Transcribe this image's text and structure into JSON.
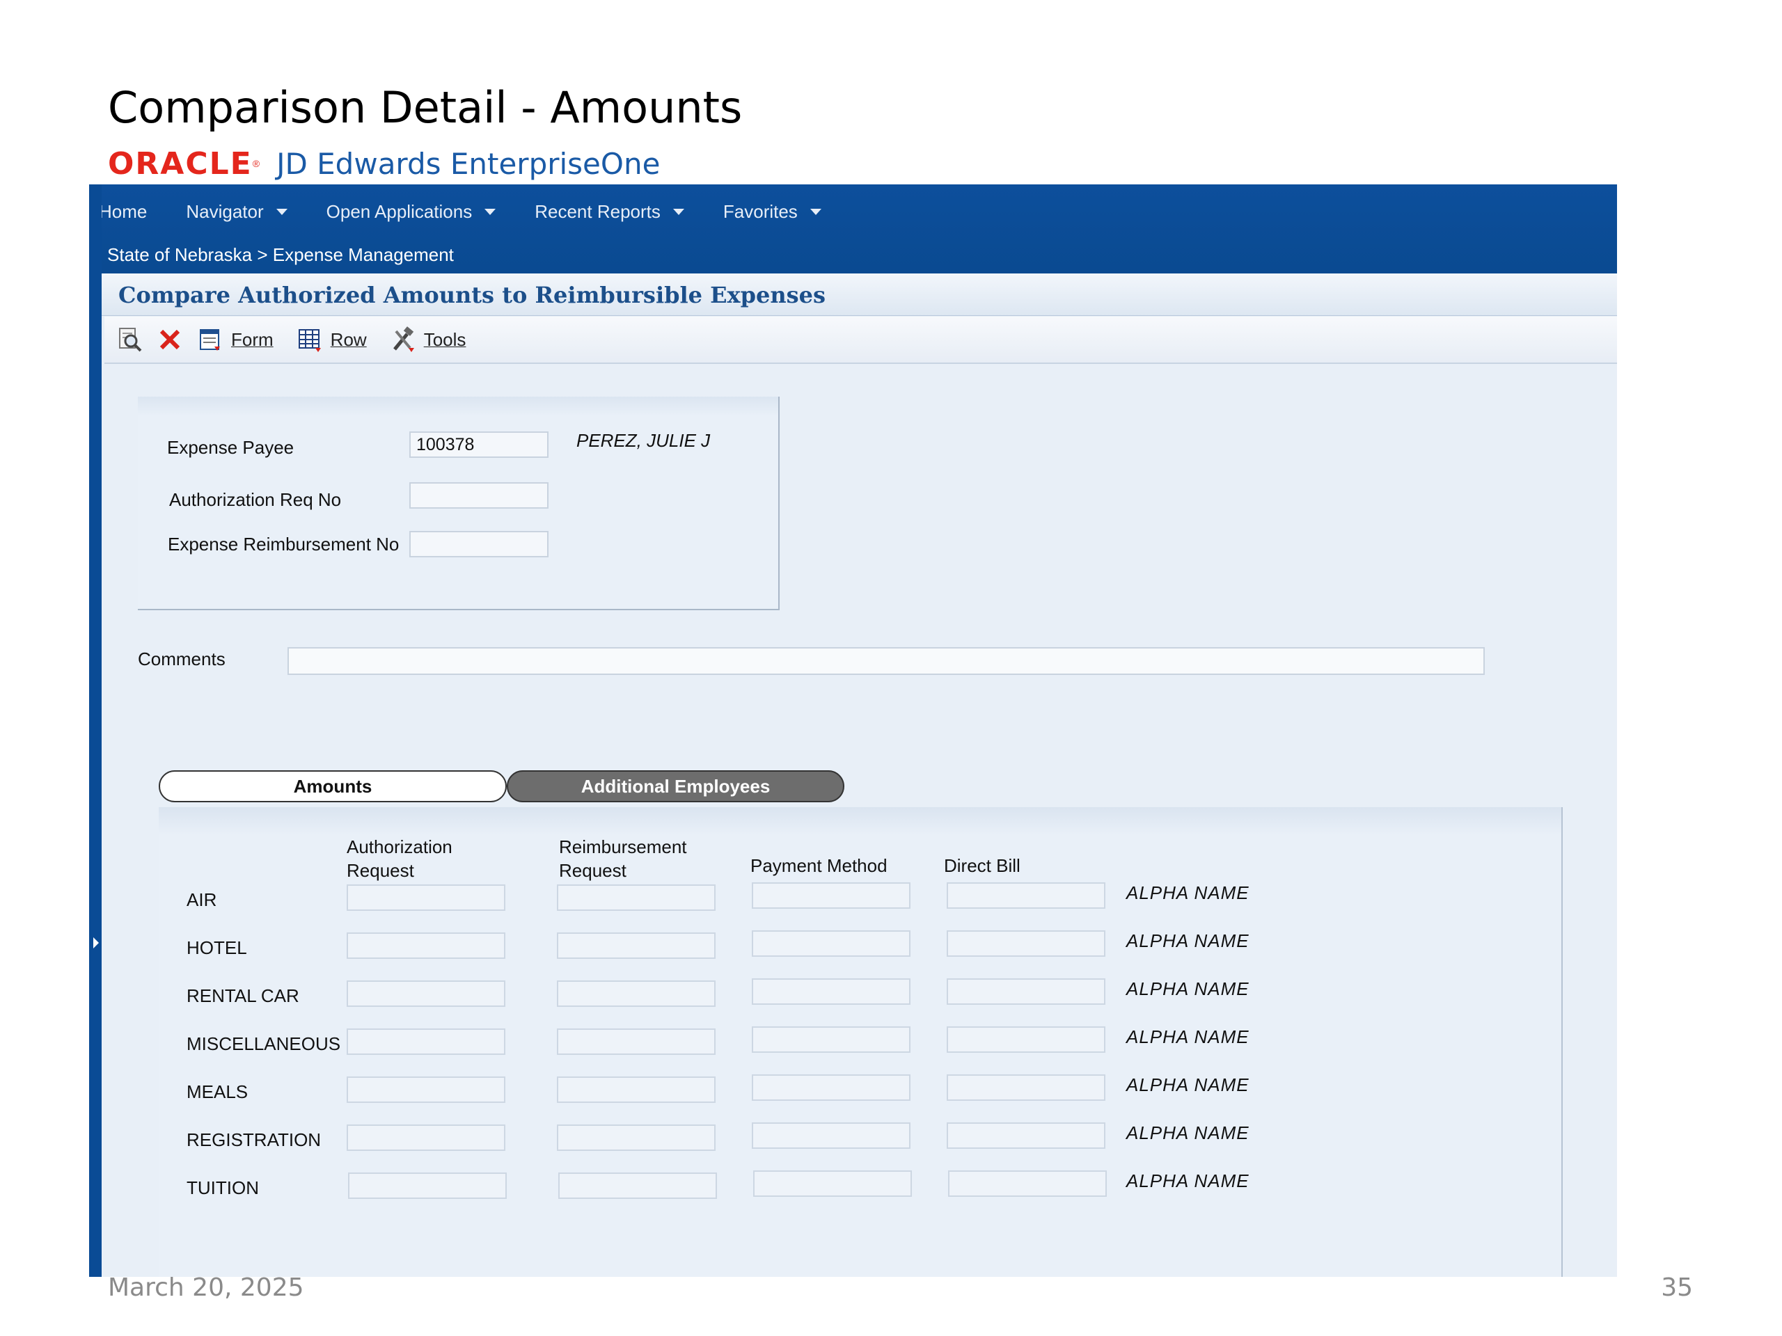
{
  "slide": {
    "title": "Comparison Detail - Amounts",
    "brand_oracle": "ORACLE",
    "brand_product": "JD Edwards EnterpriseOne",
    "footer_date": "March 20, 2025",
    "page_number": "35"
  },
  "nav": {
    "items": [
      {
        "label": "Home",
        "has_dropdown": false
      },
      {
        "label": "Navigator",
        "has_dropdown": true
      },
      {
        "label": "Open Applications",
        "has_dropdown": true
      },
      {
        "label": "Recent Reports",
        "has_dropdown": true
      },
      {
        "label": "Favorites",
        "has_dropdown": true
      }
    ],
    "breadcrumb": "State of Nebraska > Expense Management"
  },
  "form": {
    "title": "Compare Authorized Amounts to Reimbursible Expenses"
  },
  "toolbar": {
    "icons": [
      "find-icon",
      "close-icon"
    ],
    "form_label": "Form",
    "row_label": "Row",
    "tools_label": "Tools"
  },
  "header": {
    "expense_payee_label": "Expense Payee",
    "expense_payee_value": "100378",
    "expense_payee_name": "PEREZ, JULIE J",
    "auth_req_label": "Authorization Req No",
    "auth_req_value": "",
    "reimb_no_label": "Expense Reimbursement No",
    "reimb_no_value": "",
    "comments_label": "Comments",
    "comments_value": ""
  },
  "tabs": [
    {
      "label": "Amounts",
      "active": true
    },
    {
      "label": "Additional Employees",
      "active": false
    }
  ],
  "grid": {
    "columns": [
      {
        "line1": "Authorization",
        "line2": "Request"
      },
      {
        "line1": "Reimbursement",
        "line2": "Request"
      },
      {
        "line1": "Payment Method",
        "line2": ""
      },
      {
        "line1": "Direct Bill",
        "line2": ""
      }
    ],
    "rows": [
      {
        "label": "AIR",
        "alpha": "ALPHA NAME"
      },
      {
        "label": "HOTEL",
        "alpha": "ALPHA NAME"
      },
      {
        "label": "RENTAL CAR",
        "alpha": "ALPHA NAME"
      },
      {
        "label": "MISCELLANEOUS",
        "alpha": "ALPHA NAME"
      },
      {
        "label": "MEALS",
        "alpha": "ALPHA NAME"
      },
      {
        "label": "REGISTRATION",
        "alpha": "ALPHA NAME"
      },
      {
        "label": "TUITION",
        "alpha": "ALPHA NAME"
      }
    ]
  },
  "colors": {
    "nav_blue": "#0a4b95",
    "title_blue": "#1c4f8a",
    "oracle_red": "#e4261c",
    "brand_blue": "#1a5aa6"
  }
}
